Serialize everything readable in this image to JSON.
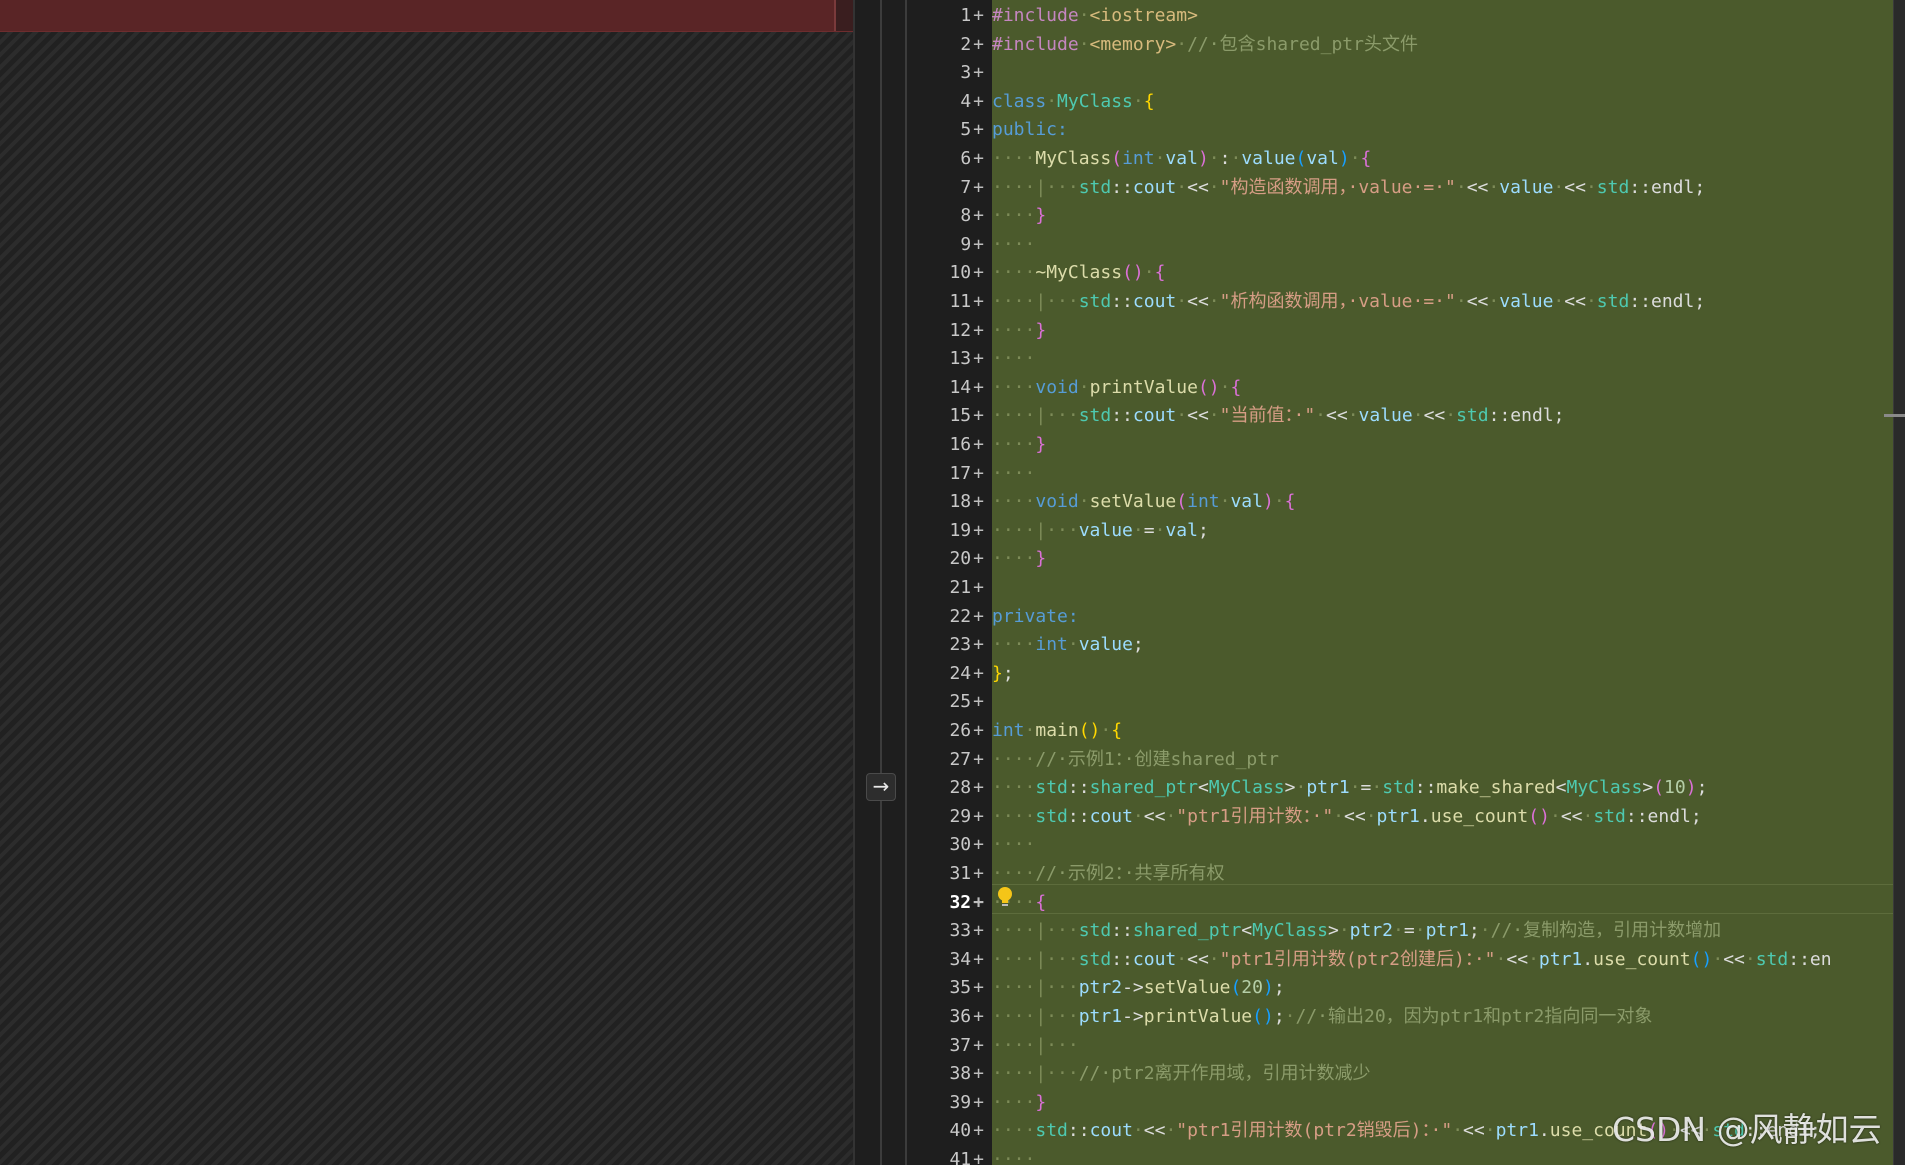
{
  "merge": {
    "arrow_glyph": "→"
  },
  "gutter": {
    "plus_glyph": "+"
  },
  "watermark": {
    "text": "CSDN @风静如云"
  },
  "colors": {
    "added_background": "#4b5a2c",
    "left_header": "#5a2526",
    "line_number": "#c8c8c8"
  },
  "editor": {
    "current_line": 32,
    "lines": [
      {
        "n": "1",
        "tokens": [
          [
            "pp",
            "#include"
          ],
          [
            "ws",
            "·"
          ],
          [
            "inc",
            "<iostream>"
          ]
        ]
      },
      {
        "n": "2",
        "tokens": [
          [
            "pp",
            "#include"
          ],
          [
            "ws",
            "·"
          ],
          [
            "inc",
            "<memory>"
          ],
          [
            "ws",
            "·"
          ],
          [
            "cm",
            "//·包含shared_ptr头文件"
          ]
        ]
      },
      {
        "n": "3",
        "tokens": []
      },
      {
        "n": "4",
        "tokens": [
          [
            "kw",
            "class"
          ],
          [
            "ws",
            "·"
          ],
          [
            "ty",
            "MyClass"
          ],
          [
            "ws",
            "·"
          ],
          [
            "br1",
            "{"
          ]
        ]
      },
      {
        "n": "5",
        "tokens": [
          [
            "kw",
            "public:"
          ]
        ]
      },
      {
        "n": "6",
        "tokens": [
          [
            "ws",
            "····"
          ],
          [
            "fn",
            "MyClass"
          ],
          [
            "br2",
            "("
          ],
          [
            "kw",
            "int"
          ],
          [
            "ws",
            "·"
          ],
          [
            "var",
            "val"
          ],
          [
            "br2",
            ")"
          ],
          [
            "ws",
            "·"
          ],
          [
            "op",
            ":"
          ],
          [
            "ws",
            "·"
          ],
          [
            "var",
            "value"
          ],
          [
            "br3",
            "("
          ],
          [
            "var",
            "val"
          ],
          [
            "br3",
            ")"
          ],
          [
            "ws",
            "·"
          ],
          [
            "br2",
            "{"
          ]
        ]
      },
      {
        "n": "7",
        "tokens": [
          [
            "ws",
            "····|···"
          ],
          [
            "ty",
            "std"
          ],
          [
            "op",
            "::"
          ],
          [
            "var",
            "cout"
          ],
          [
            "ws",
            "·"
          ],
          [
            "op",
            "<<"
          ],
          [
            "ws",
            "·"
          ],
          [
            "str",
            "\"构造函数调用，·value·=·\""
          ],
          [
            "ws",
            "·"
          ],
          [
            "op",
            "<<"
          ],
          [
            "ws",
            "·"
          ],
          [
            "var",
            "value"
          ],
          [
            "ws",
            "·"
          ],
          [
            "op",
            "<<"
          ],
          [
            "ws",
            "·"
          ],
          [
            "ty",
            "std"
          ],
          [
            "op",
            "::endl;"
          ]
        ]
      },
      {
        "n": "8",
        "tokens": [
          [
            "ws",
            "····"
          ],
          [
            "br2",
            "}"
          ]
        ]
      },
      {
        "n": "9",
        "tokens": [
          [
            "ws",
            "····"
          ]
        ]
      },
      {
        "n": "10",
        "tokens": [
          [
            "ws",
            "····"
          ],
          [
            "fn",
            "~MyClass"
          ],
          [
            "br2",
            "()"
          ],
          [
            "ws",
            "·"
          ],
          [
            "br2",
            "{"
          ]
        ]
      },
      {
        "n": "11",
        "tokens": [
          [
            "ws",
            "····|···"
          ],
          [
            "ty",
            "std"
          ],
          [
            "op",
            "::"
          ],
          [
            "var",
            "cout"
          ],
          [
            "ws",
            "·"
          ],
          [
            "op",
            "<<"
          ],
          [
            "ws",
            "·"
          ],
          [
            "str",
            "\"析构函数调用，·value·=·\""
          ],
          [
            "ws",
            "·"
          ],
          [
            "op",
            "<<"
          ],
          [
            "ws",
            "·"
          ],
          [
            "var",
            "value"
          ],
          [
            "ws",
            "·"
          ],
          [
            "op",
            "<<"
          ],
          [
            "ws",
            "·"
          ],
          [
            "ty",
            "std"
          ],
          [
            "op",
            "::endl;"
          ]
        ]
      },
      {
        "n": "12",
        "tokens": [
          [
            "ws",
            "····"
          ],
          [
            "br2",
            "}"
          ]
        ]
      },
      {
        "n": "13",
        "tokens": [
          [
            "ws",
            "····"
          ]
        ]
      },
      {
        "n": "14",
        "tokens": [
          [
            "ws",
            "····"
          ],
          [
            "kw",
            "void"
          ],
          [
            "ws",
            "·"
          ],
          [
            "fn",
            "printValue"
          ],
          [
            "br2",
            "()"
          ],
          [
            "ws",
            "·"
          ],
          [
            "br2",
            "{"
          ]
        ]
      },
      {
        "n": "15",
        "tokens": [
          [
            "ws",
            "····|···"
          ],
          [
            "ty",
            "std"
          ],
          [
            "op",
            "::"
          ],
          [
            "var",
            "cout"
          ],
          [
            "ws",
            "·"
          ],
          [
            "op",
            "<<"
          ],
          [
            "ws",
            "·"
          ],
          [
            "str",
            "\"当前值：·\""
          ],
          [
            "ws",
            "·"
          ],
          [
            "op",
            "<<"
          ],
          [
            "ws",
            "·"
          ],
          [
            "var",
            "value"
          ],
          [
            "ws",
            "·"
          ],
          [
            "op",
            "<<"
          ],
          [
            "ws",
            "·"
          ],
          [
            "ty",
            "std"
          ],
          [
            "op",
            "::endl;"
          ]
        ]
      },
      {
        "n": "16",
        "tokens": [
          [
            "ws",
            "····"
          ],
          [
            "br2",
            "}"
          ]
        ]
      },
      {
        "n": "17",
        "tokens": [
          [
            "ws",
            "····"
          ]
        ]
      },
      {
        "n": "18",
        "tokens": [
          [
            "ws",
            "····"
          ],
          [
            "kw",
            "void"
          ],
          [
            "ws",
            "·"
          ],
          [
            "fn",
            "setValue"
          ],
          [
            "br2",
            "("
          ],
          [
            "kw",
            "int"
          ],
          [
            "ws",
            "·"
          ],
          [
            "var",
            "val"
          ],
          [
            "br2",
            ")"
          ],
          [
            "ws",
            "·"
          ],
          [
            "br2",
            "{"
          ]
        ]
      },
      {
        "n": "19",
        "tokens": [
          [
            "ws",
            "····|···"
          ],
          [
            "var",
            "value"
          ],
          [
            "ws",
            "·"
          ],
          [
            "op",
            "="
          ],
          [
            "ws",
            "·"
          ],
          [
            "var",
            "val"
          ],
          [
            "op",
            ";"
          ]
        ]
      },
      {
        "n": "20",
        "tokens": [
          [
            "ws",
            "····"
          ],
          [
            "br2",
            "}"
          ]
        ]
      },
      {
        "n": "21",
        "tokens": []
      },
      {
        "n": "22",
        "tokens": [
          [
            "kw",
            "private:"
          ]
        ]
      },
      {
        "n": "23",
        "tokens": [
          [
            "ws",
            "····"
          ],
          [
            "kw",
            "int"
          ],
          [
            "ws",
            "·"
          ],
          [
            "var",
            "value"
          ],
          [
            "op",
            ";"
          ]
        ]
      },
      {
        "n": "24",
        "tokens": [
          [
            "br1",
            "}"
          ],
          [
            "op",
            ";"
          ]
        ]
      },
      {
        "n": "25",
        "tokens": []
      },
      {
        "n": "26",
        "tokens": [
          [
            "kw",
            "int"
          ],
          [
            "ws",
            "·"
          ],
          [
            "fn",
            "main"
          ],
          [
            "br1",
            "()"
          ],
          [
            "ws",
            "·"
          ],
          [
            "br1",
            "{"
          ]
        ]
      },
      {
        "n": "27",
        "tokens": [
          [
            "ws",
            "····"
          ],
          [
            "cm",
            "//·示例1：·创建shared_ptr"
          ]
        ]
      },
      {
        "n": "28",
        "tokens": [
          [
            "ws",
            "····"
          ],
          [
            "ty",
            "std"
          ],
          [
            "op",
            "::"
          ],
          [
            "ty",
            "shared_ptr"
          ],
          [
            "op",
            "<"
          ],
          [
            "ty",
            "MyClass"
          ],
          [
            "op",
            ">"
          ],
          [
            "ws",
            "·"
          ],
          [
            "var",
            "ptr1"
          ],
          [
            "ws",
            "·"
          ],
          [
            "op",
            "="
          ],
          [
            "ws",
            "·"
          ],
          [
            "ty",
            "std"
          ],
          [
            "op",
            "::"
          ],
          [
            "fn",
            "make_shared"
          ],
          [
            "op",
            "<"
          ],
          [
            "ty",
            "MyClass"
          ],
          [
            "op",
            ">"
          ],
          [
            "br2",
            "("
          ],
          [
            "num",
            "10"
          ],
          [
            "br2",
            ")"
          ],
          [
            "op",
            ";"
          ]
        ]
      },
      {
        "n": "29",
        "tokens": [
          [
            "ws",
            "····"
          ],
          [
            "ty",
            "std"
          ],
          [
            "op",
            "::"
          ],
          [
            "var",
            "cout"
          ],
          [
            "ws",
            "·"
          ],
          [
            "op",
            "<<"
          ],
          [
            "ws",
            "·"
          ],
          [
            "str",
            "\"ptr1引用计数：·\""
          ],
          [
            "ws",
            "·"
          ],
          [
            "op",
            "<<"
          ],
          [
            "ws",
            "·"
          ],
          [
            "var",
            "ptr1"
          ],
          [
            "op",
            "."
          ],
          [
            "fn",
            "use_count"
          ],
          [
            "br2",
            "()"
          ],
          [
            "ws",
            "·"
          ],
          [
            "op",
            "<<"
          ],
          [
            "ws",
            "·"
          ],
          [
            "ty",
            "std"
          ],
          [
            "op",
            "::endl;"
          ]
        ]
      },
      {
        "n": "30",
        "tokens": [
          [
            "ws",
            "····"
          ]
        ]
      },
      {
        "n": "31",
        "tokens": [
          [
            "ws",
            "····"
          ],
          [
            "cm",
            "//·示例2：·共享所有权"
          ]
        ]
      },
      {
        "n": "32",
        "tokens": [
          [
            "ws",
            "····"
          ],
          [
            "br2",
            "{"
          ]
        ]
      },
      {
        "n": "33",
        "tokens": [
          [
            "ws",
            "····|···"
          ],
          [
            "ty",
            "std"
          ],
          [
            "op",
            "::"
          ],
          [
            "ty",
            "shared_ptr"
          ],
          [
            "op",
            "<"
          ],
          [
            "ty",
            "MyClass"
          ],
          [
            "op",
            ">"
          ],
          [
            "ws",
            "·"
          ],
          [
            "var",
            "ptr2"
          ],
          [
            "ws",
            "·"
          ],
          [
            "op",
            "="
          ],
          [
            "ws",
            "·"
          ],
          [
            "var",
            "ptr1"
          ],
          [
            "op",
            ";"
          ],
          [
            "ws",
            "·"
          ],
          [
            "cm",
            "//·复制构造，引用计数增加"
          ]
        ]
      },
      {
        "n": "34",
        "tokens": [
          [
            "ws",
            "····|···"
          ],
          [
            "ty",
            "std"
          ],
          [
            "op",
            "::"
          ],
          [
            "var",
            "cout"
          ],
          [
            "ws",
            "·"
          ],
          [
            "op",
            "<<"
          ],
          [
            "ws",
            "·"
          ],
          [
            "str",
            "\"ptr1引用计数(ptr2创建后)：·\""
          ],
          [
            "ws",
            "·"
          ],
          [
            "op",
            "<<"
          ],
          [
            "ws",
            "·"
          ],
          [
            "var",
            "ptr1"
          ],
          [
            "op",
            "."
          ],
          [
            "fn",
            "use_count"
          ],
          [
            "br3",
            "()"
          ],
          [
            "ws",
            "·"
          ],
          [
            "op",
            "<<"
          ],
          [
            "ws",
            "·"
          ],
          [
            "ty",
            "std"
          ],
          [
            "op",
            "::en"
          ]
        ]
      },
      {
        "n": "35",
        "tokens": [
          [
            "ws",
            "····|···"
          ],
          [
            "var",
            "ptr2"
          ],
          [
            "op",
            "->"
          ],
          [
            "fn",
            "setValue"
          ],
          [
            "br3",
            "("
          ],
          [
            "num",
            "20"
          ],
          [
            "br3",
            ")"
          ],
          [
            "op",
            ";"
          ]
        ]
      },
      {
        "n": "36",
        "tokens": [
          [
            "ws",
            "····|···"
          ],
          [
            "var",
            "ptr1"
          ],
          [
            "op",
            "->"
          ],
          [
            "fn",
            "printValue"
          ],
          [
            "br3",
            "()"
          ],
          [
            "op",
            ";"
          ],
          [
            "ws",
            "·"
          ],
          [
            "cm",
            "//·输出20，因为ptr1和ptr2指向同一对象"
          ]
        ]
      },
      {
        "n": "37",
        "tokens": [
          [
            "ws",
            "····|···"
          ]
        ]
      },
      {
        "n": "38",
        "tokens": [
          [
            "ws",
            "····|···"
          ],
          [
            "cm",
            "//·ptr2离开作用域，引用计数减少"
          ]
        ]
      },
      {
        "n": "39",
        "tokens": [
          [
            "ws",
            "····"
          ],
          [
            "br2",
            "}"
          ]
        ]
      },
      {
        "n": "40",
        "tokens": [
          [
            "ws",
            "····"
          ],
          [
            "ty",
            "std"
          ],
          [
            "op",
            "::"
          ],
          [
            "var",
            "cout"
          ],
          [
            "ws",
            "·"
          ],
          [
            "op",
            "<<"
          ],
          [
            "ws",
            "·"
          ],
          [
            "str",
            "\"ptr1引用计数(ptr2销毁后)：·\""
          ],
          [
            "ws",
            "·"
          ],
          [
            "op",
            "<<"
          ],
          [
            "ws",
            "·"
          ],
          [
            "var",
            "ptr1"
          ],
          [
            "op",
            "."
          ],
          [
            "fn",
            "use_count"
          ],
          [
            "br2",
            "()"
          ],
          [
            "ws",
            "·"
          ],
          [
            "op",
            "<<"
          ],
          [
            "ws",
            "·"
          ],
          [
            "ty",
            "std"
          ],
          [
            "op",
            "::endl;"
          ]
        ]
      },
      {
        "n": "41",
        "tokens": [
          [
            "ws",
            "····"
          ]
        ]
      }
    ]
  }
}
